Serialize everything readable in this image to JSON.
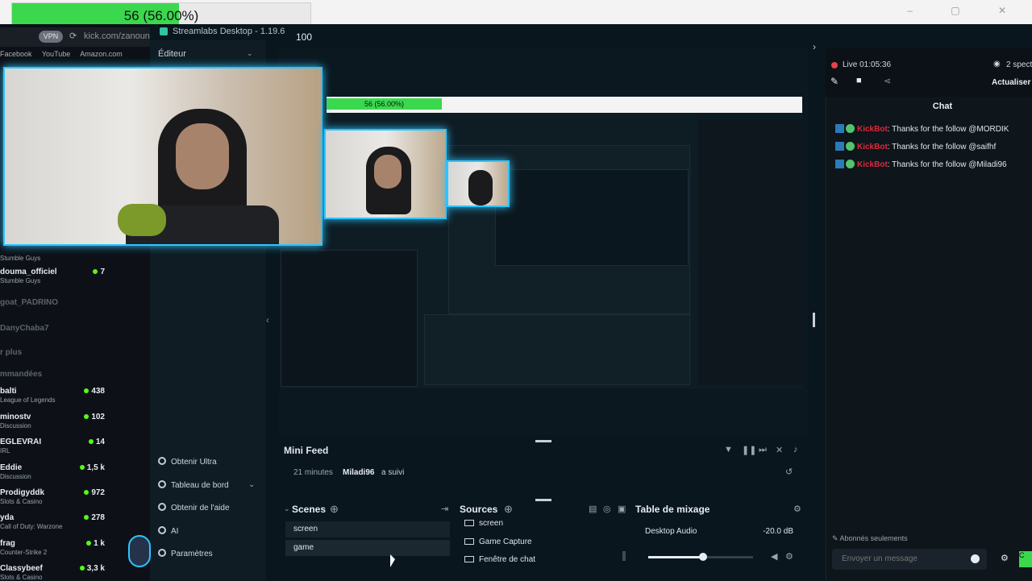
{
  "progress": {
    "label": "56 (56.00%)",
    "fraction": 0.56
  },
  "browser": {
    "url": "kick.com/zanouni",
    "vpn_label": "VPN",
    "bookmarks": [
      "Facebook",
      "YouTube",
      "Amazon.com"
    ]
  },
  "streamlabs": {
    "title": "Streamlabs Desktop - 1.19.6",
    "counter": "100",
    "editor_label": "Éditeur",
    "nav": {
      "ultra": "Obtenir Ultra",
      "dashboard": "Tableau de bord",
      "help": "Obtenir de l'aide",
      "ai": "AI",
      "settings": "Paramètres"
    }
  },
  "sidebar": {
    "items": [
      {
        "name": "",
        "category": "Stumble Guys",
        "count": ""
      },
      {
        "name": "douma_officiel",
        "category": "Stumble Guys",
        "count": "7"
      },
      {
        "name": "goat_PADRINO",
        "category": "",
        "count": ""
      },
      {
        "name": "DanyChaba7",
        "category": "",
        "count": ""
      },
      {
        "name": "r plus",
        "category": "",
        "count": ""
      },
      {
        "name": "mmandées",
        "category": "",
        "count": ""
      },
      {
        "name": "balti",
        "category": "League of Legends",
        "count": "438"
      },
      {
        "name": "minostv",
        "category": "Discussion",
        "count": "102"
      },
      {
        "name": "EGLEVRAI",
        "category": "IRL",
        "count": "14"
      },
      {
        "name": "Eddie",
        "category": "Discussion",
        "count": "1,5 k"
      },
      {
        "name": "Prodigyddk",
        "category": "Slots & Casino",
        "count": "972"
      },
      {
        "name": "yda",
        "category": "Call of Duty: Warzone",
        "count": "278"
      },
      {
        "name": "frag",
        "category": "Counter-Strike 2",
        "count": "1 k"
      },
      {
        "name": "Classybeef",
        "category": "Slots & Casino",
        "count": "3,3 k"
      }
    ]
  },
  "nested": {
    "progress_label": "56 (56.00%)"
  },
  "mini_feed": {
    "title": "Mini Feed",
    "time": "21 minutes",
    "user": "Miladi96",
    "action": "a suivi"
  },
  "scenes": {
    "title": "Scenes",
    "items": [
      "screen",
      "game"
    ]
  },
  "sources": {
    "title": "Sources",
    "items": [
      "screen",
      "Game Capture",
      "Fenêtre de chat"
    ]
  },
  "mixer": {
    "title": "Table de mixage",
    "channel": "Desktop Audio",
    "level": "-20.0 dB",
    "volume": 0.52
  },
  "chat": {
    "live": "Live 01:05:36",
    "viewers": "2 spect",
    "refresh": "Actualiser l",
    "title": "Chat",
    "messages": [
      {
        "user": "KickBot",
        "text": ": Thanks for the follow @MORDIK"
      },
      {
        "user": "KickBot",
        "text": ": Thanks for the follow @saifhf"
      },
      {
        "user": "KickBot",
        "text": ": Thanks for the follow @Miladi96"
      }
    ],
    "subs_only": "Abonnés seulements",
    "input_placeholder": "Envoyer un message",
    "send_label": "C"
  },
  "colors": {
    "accent": "#53fc18",
    "progress": "#3bd84e",
    "cam_border": "#2ec4ff",
    "bot": "#e0283a"
  }
}
